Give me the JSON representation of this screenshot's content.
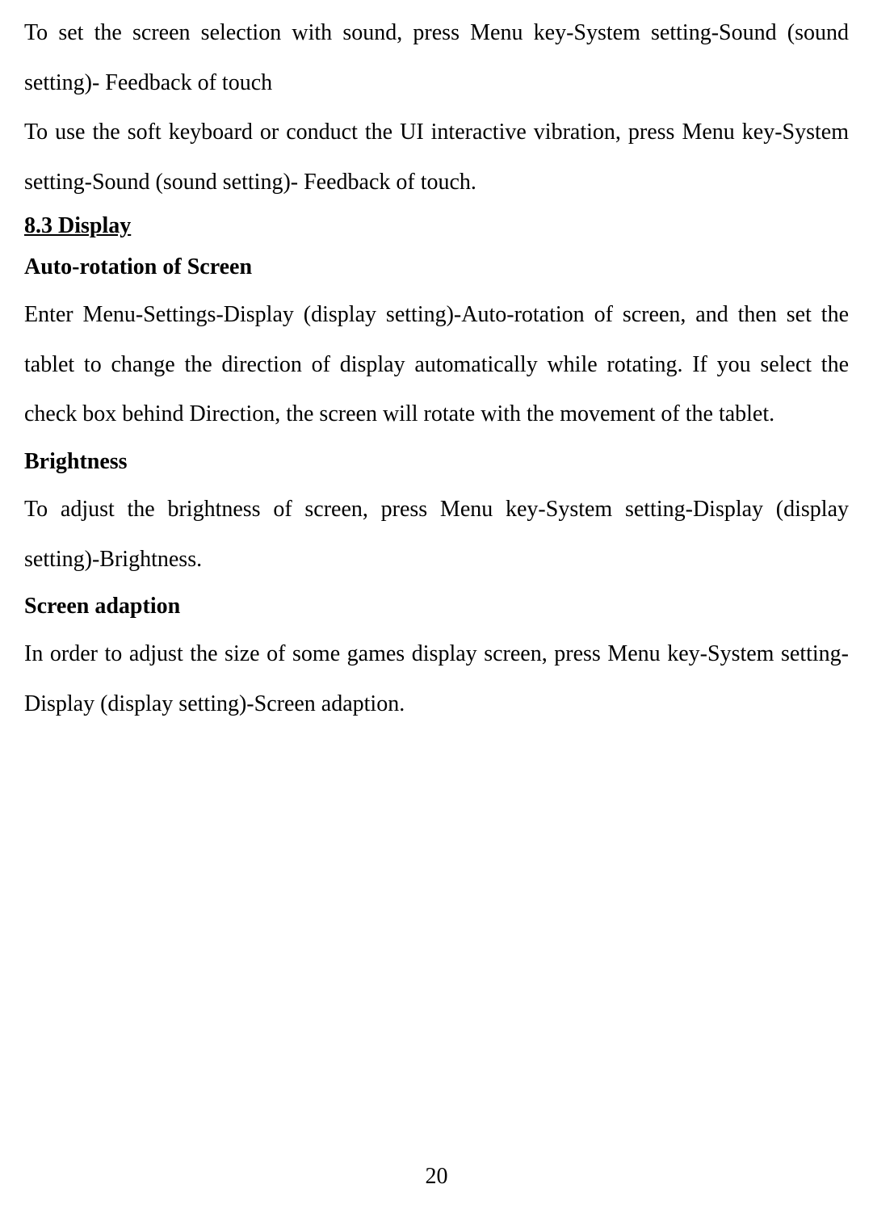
{
  "para1": "To set the screen selection with sound, press Menu key-System setting-Sound (sound setting)- Feedback of touch",
  "para2": "To use the soft keyboard or conduct the UI interactive vibration, press Menu key-System setting-Sound (sound setting)- Feedback of touch.",
  "section": {
    "heading": "8.3 Display"
  },
  "autorotation": {
    "heading": "Auto-rotation of Screen",
    "body": "Enter Menu-Settings-Display (display setting)-Auto-rotation of screen, and then set the tablet to change the direction of display automatically while rotating. If you select the check box behind Direction, the screen will rotate with the movement of the tablet."
  },
  "brightness": {
    "heading": "Brightness",
    "body": "To adjust the brightness of screen, press Menu key-System setting-Display (display setting)-Brightness."
  },
  "adaption": {
    "heading": "Screen adaption",
    "body": "In order to adjust the size of some games display screen, press Menu key-System setting-Display (display setting)-Screen adaption."
  },
  "pageNumber": "20"
}
